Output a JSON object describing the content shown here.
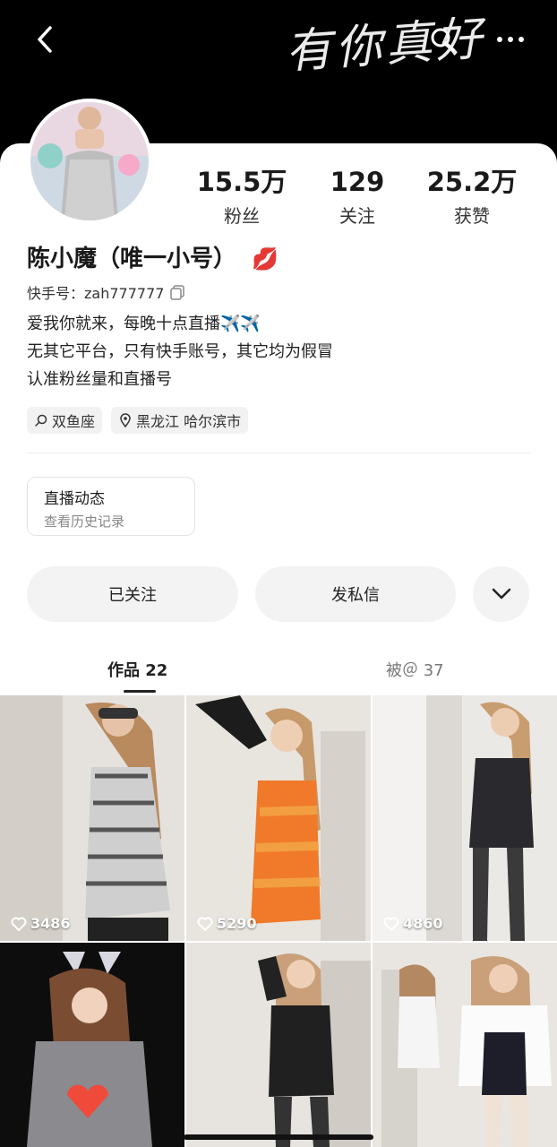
{
  "header": {
    "background_text": "有你真好",
    "back_icon": "chevron-left-icon",
    "search_icon": "search-icon",
    "more_icon": "more-dots-icon"
  },
  "profile": {
    "stats": [
      {
        "value": "15.5万",
        "label": "粉丝"
      },
      {
        "value": "129",
        "label": "关注"
      },
      {
        "value": "25.2万",
        "label": "获赞"
      }
    ],
    "name": "陈小魔（唯一小号）",
    "name_emoji": "💋",
    "kuaishou_label": "快手号：zah777777",
    "bio": [
      "爱我你就来，每晚十点直播✈️✈️",
      "无其它平台，只有快手账号，其它均为假冒",
      "认准粉丝量和直播号"
    ],
    "tags": [
      {
        "icon": "zodiac-icon",
        "text": "双鱼座"
      },
      {
        "icon": "location-pin-icon",
        "text": "黑龙江 哈尔滨市"
      }
    ]
  },
  "live_card": {
    "title": "直播动态",
    "subtitle": "查看历史记录"
  },
  "actions": {
    "followed": "已关注",
    "message": "发私信",
    "expand_icon": "chevron-down-icon"
  },
  "tabs": [
    {
      "label": "作品 22",
      "active": true
    },
    {
      "label": "被＠ 37",
      "active": false
    }
  ],
  "posts": [
    {
      "likes": "3486"
    },
    {
      "likes": "5290"
    },
    {
      "likes": "4860"
    },
    {
      "likes": ""
    },
    {
      "likes": ""
    },
    {
      "likes": ""
    }
  ],
  "colors": {
    "accent": "#222222",
    "button_bg": "#f3f3f3",
    "header_bg": "#000000"
  }
}
